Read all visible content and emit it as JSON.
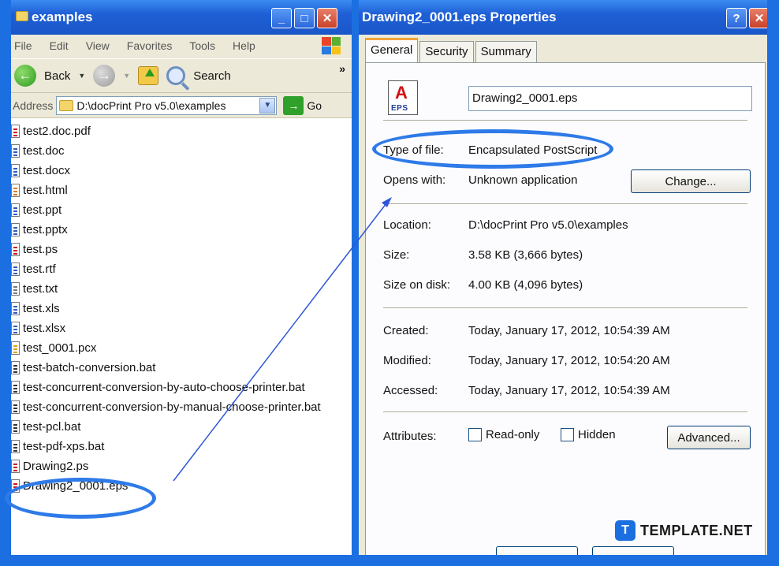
{
  "explorer": {
    "title": "examples",
    "window_buttons": [
      "_",
      "□",
      "✕"
    ],
    "menu": [
      "File",
      "Edit",
      "View",
      "Favorites",
      "Tools",
      "Help"
    ],
    "toolbar": {
      "back_label": "Back",
      "search_label": "Search",
      "more": "»"
    },
    "address": {
      "label": "Address",
      "path": "D:\\docPrint Pro v5.0\\examples",
      "go_label": "Go"
    },
    "files": [
      {
        "name": "test2.doc.pdf",
        "icon": "pdf-file-icon",
        "color": "#d01010"
      },
      {
        "name": "test.doc",
        "icon": "word-file-icon",
        "color": "#2a5cc8"
      },
      {
        "name": "test.docx",
        "icon": "word-file-icon",
        "color": "#2a5cc8"
      },
      {
        "name": "test.html",
        "icon": "html-file-icon",
        "color": "#e07a10"
      },
      {
        "name": "test.ppt",
        "icon": "powerpoint-file-icon",
        "color": "#2a5cc8"
      },
      {
        "name": "test.pptx",
        "icon": "powerpoint-file-icon",
        "color": "#2a5cc8"
      },
      {
        "name": "test.ps",
        "icon": "postscript-file-icon",
        "color": "#d01010"
      },
      {
        "name": "test.rtf",
        "icon": "rtf-file-icon",
        "color": "#2a5cc8"
      },
      {
        "name": "test.txt",
        "icon": "text-file-icon",
        "color": "#777777"
      },
      {
        "name": "test.xls",
        "icon": "excel-file-icon",
        "color": "#2a5cc8"
      },
      {
        "name": "test.xlsx",
        "icon": "excel-file-icon",
        "color": "#2a5cc8"
      },
      {
        "name": "test_0001.pcx",
        "icon": "image-file-icon",
        "color": "#e0a010"
      },
      {
        "name": "test-batch-conversion.bat",
        "icon": "batch-file-icon",
        "color": "#333333"
      },
      {
        "name": "test-concurrent-conversion-by-auto-choose-printer.bat",
        "icon": "batch-file-icon",
        "color": "#333333"
      },
      {
        "name": "test-concurrent-conversion-by-manual-choose-printer.bat",
        "icon": "batch-file-icon",
        "color": "#333333"
      },
      {
        "name": "test-pcl.bat",
        "icon": "batch-file-icon",
        "color": "#333333"
      },
      {
        "name": "test-pdf-xps.bat",
        "icon": "batch-file-icon",
        "color": "#333333"
      },
      {
        "name": "Drawing2.ps",
        "icon": "postscript-file-icon",
        "color": "#d01010"
      },
      {
        "name": "Drawing2_0001.eps",
        "icon": "eps-file-icon",
        "color": "#d01010"
      }
    ]
  },
  "properties": {
    "title": "Drawing2_0001.eps Properties",
    "window_buttons": [
      "?",
      "✕"
    ],
    "tabs": [
      "General",
      "Security",
      "Summary"
    ],
    "filename": "Drawing2_0001.eps",
    "icon_letter": "A",
    "icon_text": "EPS",
    "fields": {
      "type_label": "Type of file:",
      "type_value": "Encapsulated PostScript",
      "opens_label": "Opens with:",
      "opens_value": "Unknown application",
      "change_label": "Change...",
      "location_label": "Location:",
      "location_value": "D:\\docPrint Pro v5.0\\examples",
      "size_label": "Size:",
      "size_value": "3.58 KB (3,666 bytes)",
      "disk_label": "Size on disk:",
      "disk_value": "4.00 KB (4,096 bytes)",
      "created_label": "Created:",
      "created_value": "Today, January 17, 2012, 10:54:39 AM",
      "modified_label": "Modified:",
      "modified_value": "Today, January 17, 2012, 10:54:20 AM",
      "accessed_label": "Accessed:",
      "accessed_value": "Today, January 17, 2012, 10:54:39 AM",
      "attributes_label": "Attributes:",
      "readonly_label": "Read-only",
      "hidden_label": "Hidden",
      "advanced_label": "Advanced..."
    }
  },
  "watermark": {
    "letter": "T",
    "text": "TEMPLATE.NET"
  },
  "colors": {
    "background": "#1c6fe0",
    "highlight": "#2e7ae8",
    "titlebar": "#1f5fd6"
  }
}
